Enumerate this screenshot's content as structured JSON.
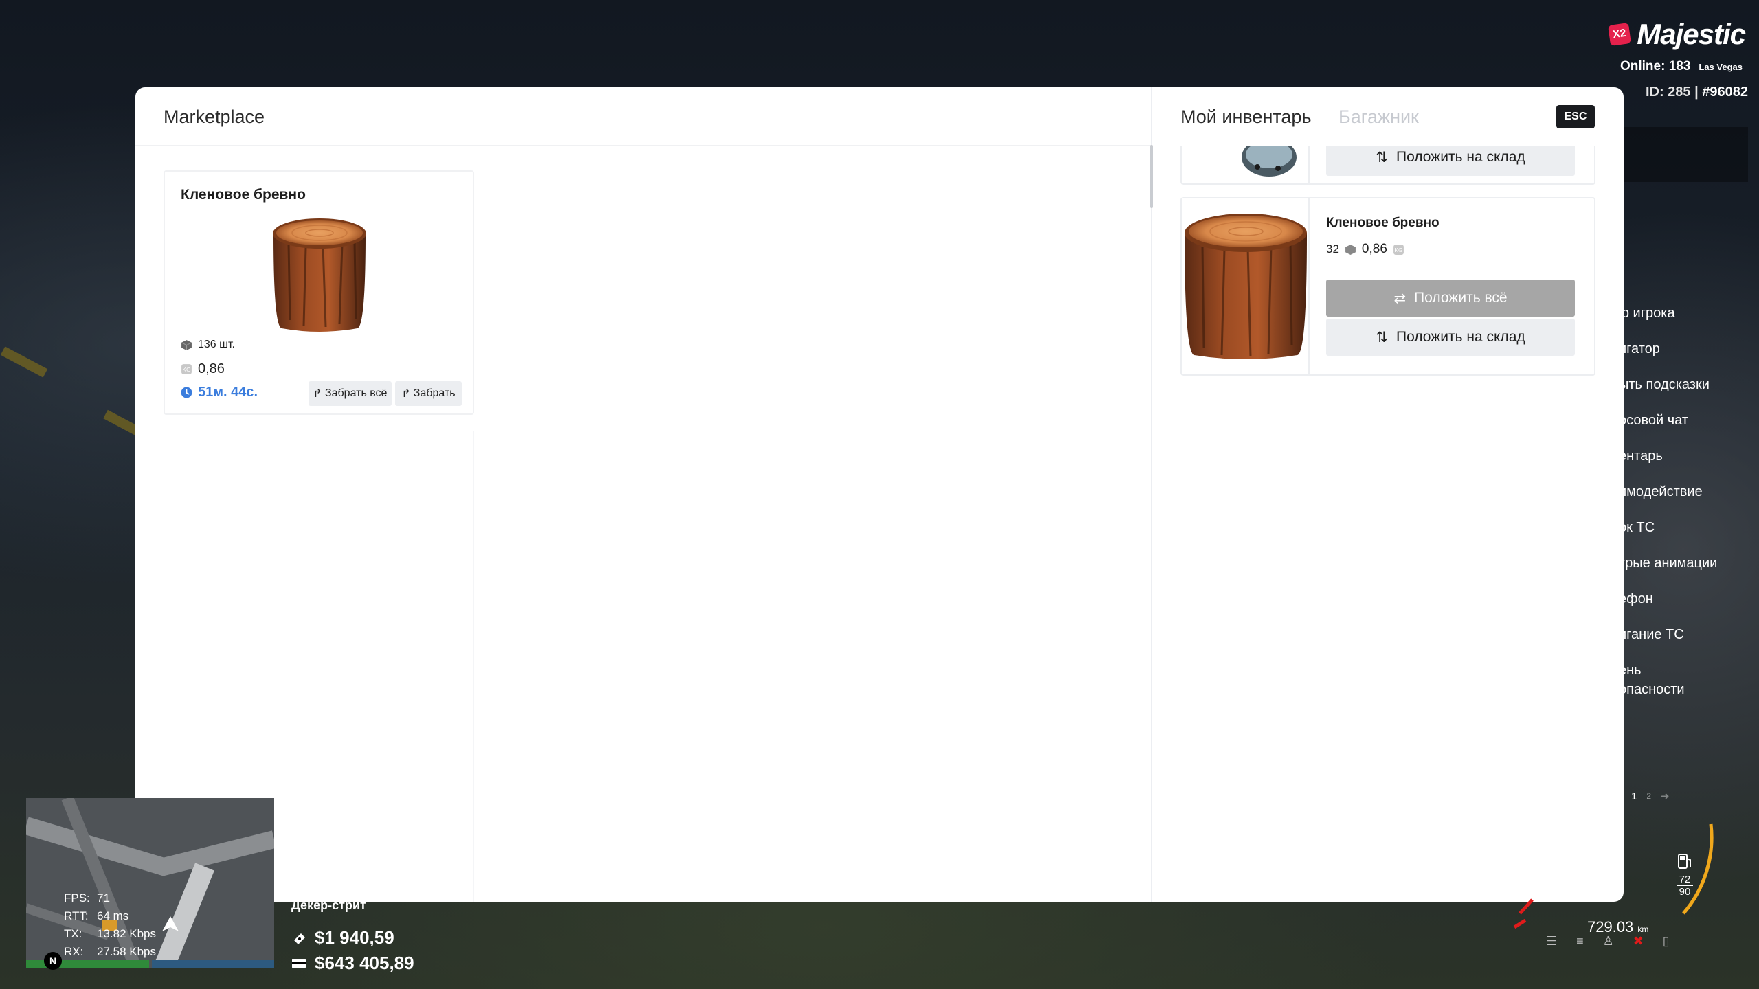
{
  "hud": {
    "brand_badge": "X2",
    "brand_name": "Majestic",
    "online_label": "Online: 183",
    "city": "Las Vegas",
    "id_prefix": "ID: 285 | ",
    "id_value": "#96082",
    "side_menu": [
      "ю игрока",
      "игатор",
      "ыть подсказки",
      "осовой чат",
      "ентарь",
      "имодействие",
      "ок ТС",
      "трые анимации",
      "ефон",
      "игание ТС",
      "ень опасности"
    ],
    "pager": [
      "1",
      "2"
    ],
    "fuel_current": "72",
    "fuel_max": "90",
    "odometer": "729.03",
    "odometer_unit": "km",
    "stats": [
      {
        "k": "FPS:",
        "v": "71"
      },
      {
        "k": "RTT:",
        "v": "64 ms"
      },
      {
        "k": "TX:",
        "v": "13.82 Kbps"
      },
      {
        "k": "RX:",
        "v": "27.58 Kbps"
      }
    ],
    "north": "N",
    "street": "Декер-стрит",
    "cash": "$1 940,59",
    "bank": "$643 405,89"
  },
  "marketplace": {
    "title": "Marketplace",
    "listing": {
      "name": "Кленовое бревно",
      "quantity": "136 шт.",
      "weight": "0,86",
      "timer": "51м. 44с.",
      "take_all_label": "Забрать всё",
      "take_label": "Забрать"
    }
  },
  "inventory": {
    "tabs": {
      "mine": "Мой инвентарь",
      "trunk": "Багажник"
    },
    "esc_label": "ESC",
    "prev_item": {
      "store_label": "Положить на склад"
    },
    "item": {
      "name": "Кленовое бревно",
      "count": "32",
      "weight": "0,86",
      "put_all_label": "Положить всё",
      "store_label": "Положить на склад"
    }
  },
  "colors": {
    "accent_blue": "#3b7ddd",
    "brand_red": "#e5214c",
    "button_gray": "#a6a6a6",
    "button_light": "#eceef1"
  }
}
